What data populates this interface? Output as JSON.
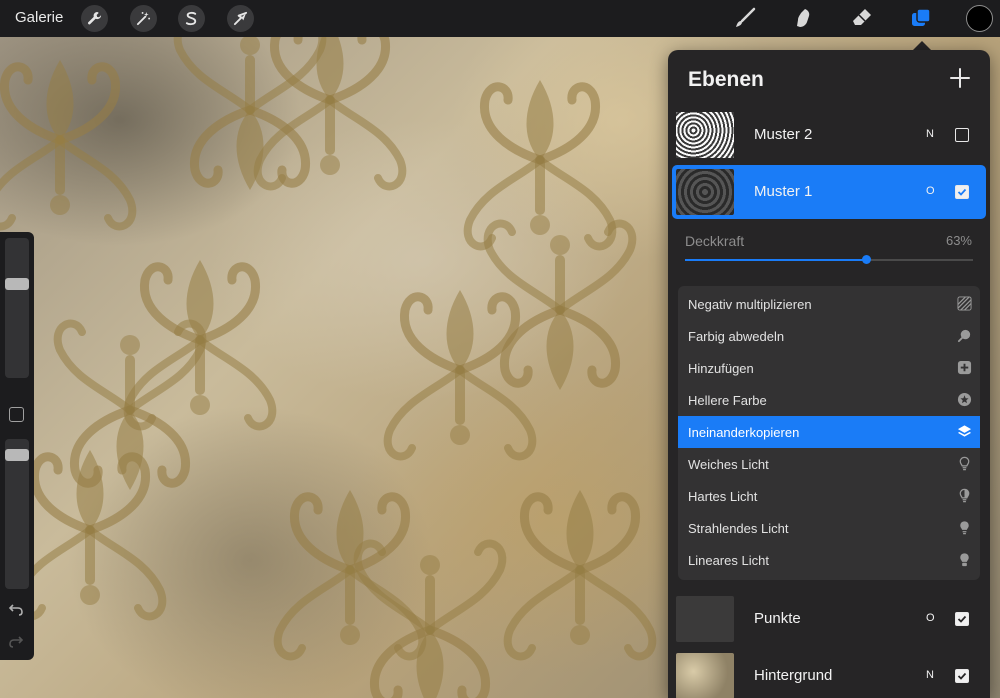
{
  "topbar": {
    "gallery_label": "Galerie",
    "left_tools": [
      {
        "name": "actions-wrench",
        "icon": "wrench-icon"
      },
      {
        "name": "adjustments-wand",
        "icon": "magic-wand-icon"
      },
      {
        "name": "selection",
        "icon": "selection-s-icon"
      },
      {
        "name": "transform",
        "icon": "arrow-cursor-icon"
      }
    ],
    "right_tools": [
      {
        "name": "brush",
        "icon": "brush-icon"
      },
      {
        "name": "smudge",
        "icon": "smudge-icon"
      },
      {
        "name": "eraser",
        "icon": "eraser-icon"
      },
      {
        "name": "layers",
        "icon": "layers-icon"
      }
    ],
    "active_color": "#000000",
    "accent_color": "#1a7cf7"
  },
  "sidebar": {
    "brush_size_level": 0.65,
    "opacity_level": 0.95,
    "undo_icon": "undo-arrow-icon",
    "redo_icon": "redo-arrow-icon"
  },
  "layers_panel": {
    "title": "Ebenen",
    "add_icon": "plus-icon",
    "layers": [
      {
        "name": "Muster 2",
        "mode": "N",
        "visible": false,
        "selected": false,
        "thumb": "pattern-light"
      },
      {
        "name": "Muster 1",
        "mode": "O",
        "visible": true,
        "selected": true,
        "thumb": "pattern-dark"
      },
      {
        "name": "Punkte",
        "mode": "O",
        "visible": true,
        "selected": false,
        "thumb": "plain-dark"
      },
      {
        "name": "Hintergrund",
        "mode": "N",
        "visible": true,
        "selected": false,
        "thumb": "texture"
      }
    ],
    "opacity": {
      "label": "Deckkraft",
      "value_text": "63%",
      "value": 0.63
    },
    "blend_modes": [
      {
        "label": "Negativ multiplizieren",
        "icon": "hatch-icon",
        "selected": false
      },
      {
        "label": "Farbig abwedeln",
        "icon": "dodge-icon",
        "selected": false
      },
      {
        "label": "Hinzufügen",
        "icon": "plus-square-icon",
        "selected": false
      },
      {
        "label": "Hellere Farbe",
        "icon": "star-circle-icon",
        "selected": false
      },
      {
        "label": "Ineinanderkopieren",
        "icon": "layers-stack-icon",
        "selected": true
      },
      {
        "label": "Weiches Licht",
        "icon": "bulb-outline-icon",
        "selected": false
      },
      {
        "label": "Hartes Licht",
        "icon": "bulb-half-icon",
        "selected": false
      },
      {
        "label": "Strahlendes Licht",
        "icon": "bulb-filled-icon",
        "selected": false
      },
      {
        "label": "Lineares Licht",
        "icon": "bulb-solid-icon",
        "selected": false
      }
    ]
  }
}
